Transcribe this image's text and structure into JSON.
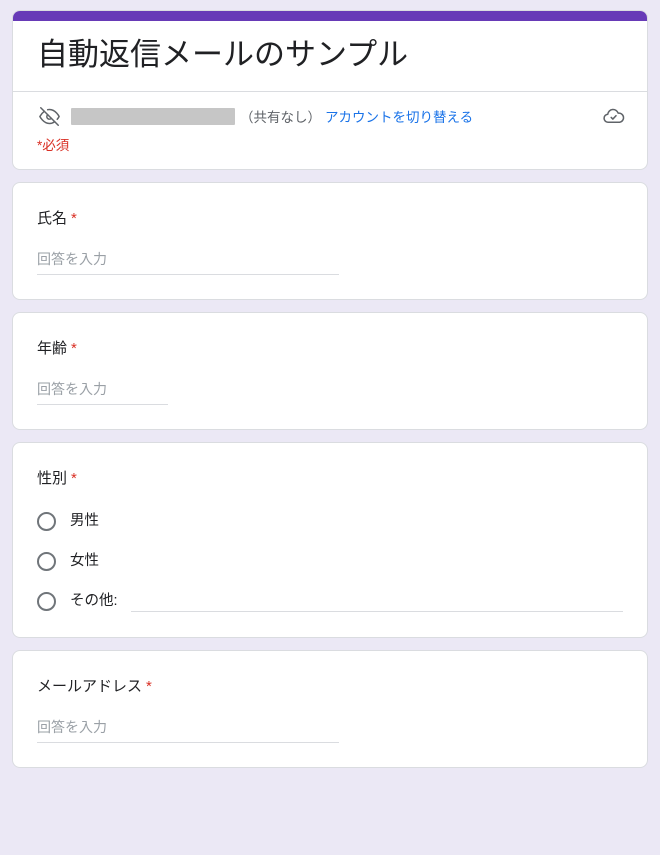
{
  "theme": {
    "accent_color": "#673ab7",
    "page_background": "#ebe8f5",
    "card_background": "#ffffff",
    "link_color": "#1a73e8",
    "required_color": "#d93025"
  },
  "header": {
    "title": "自動返信メールのサンプル",
    "account": {
      "visibility_icon": "eye-off-icon",
      "email_redacted": "",
      "sharing_status": "（共有なし）",
      "switch_account_label": "アカウントを切り替える",
      "saved_icon": "cloud-done-icon"
    },
    "required_note": "*必須"
  },
  "questions": [
    {
      "label": "氏名",
      "required_marker": "*",
      "type": "short-answer",
      "placeholder": "回答を入力",
      "value": "",
      "width": "wide"
    },
    {
      "label": "年齢",
      "required_marker": "*",
      "type": "short-answer",
      "placeholder": "回答を入力",
      "value": "",
      "width": "narrow"
    },
    {
      "label": "性別",
      "required_marker": "*",
      "type": "radio",
      "options": [
        {
          "label": "男性",
          "selected": false,
          "has_input": false
        },
        {
          "label": "女性",
          "selected": false,
          "has_input": false
        },
        {
          "label": "その他:",
          "selected": false,
          "has_input": true,
          "input_value": "",
          "input_placeholder": ""
        }
      ]
    },
    {
      "label": "メールアドレス",
      "required_marker": "*",
      "type": "short-answer",
      "placeholder": "回答を入力",
      "value": "",
      "width": "wide"
    }
  ]
}
